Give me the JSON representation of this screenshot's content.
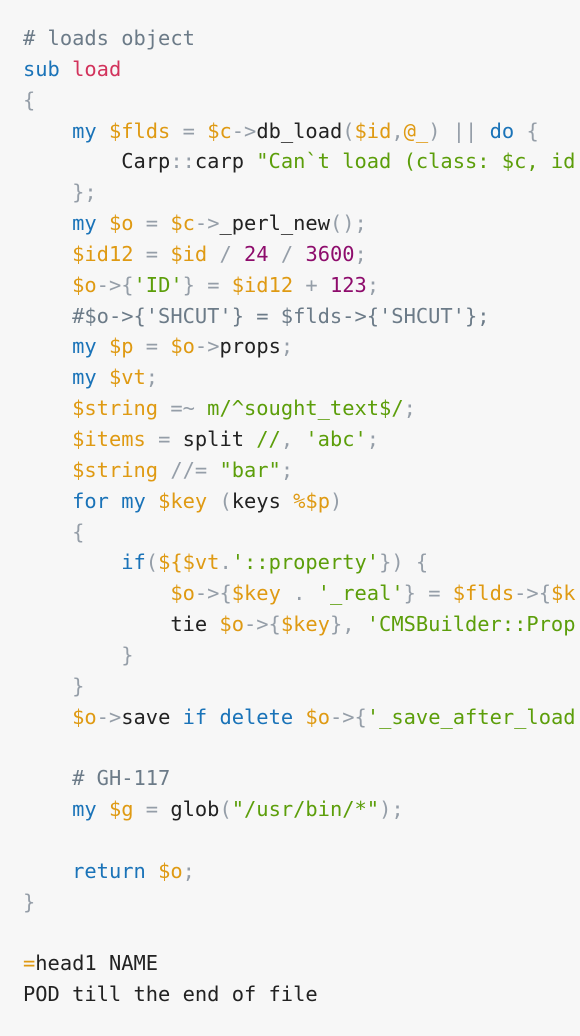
{
  "editor": {
    "background": "#f7f7f7",
    "token_colors": {
      "comment": "#6c7b88",
      "keyword": "#1a73b8",
      "function_name": "#d2335c",
      "variable": "#df9a13",
      "string": "#5c9e0a",
      "number": "#8e0c6c",
      "operator": "#959ea8",
      "plain": "#222222"
    },
    "lines": [
      [
        [
          "comment",
          "# loads object"
        ]
      ],
      [
        [
          "keyword",
          "sub"
        ],
        [
          "plain",
          " "
        ],
        [
          "func",
          "load"
        ]
      ],
      [
        [
          "op",
          "{"
        ]
      ],
      [
        [
          "plain",
          "    "
        ],
        [
          "keyword",
          "my"
        ],
        [
          "plain",
          " "
        ],
        [
          "var",
          "$flds"
        ],
        [
          "plain",
          " "
        ],
        [
          "op",
          "="
        ],
        [
          "plain",
          " "
        ],
        [
          "var",
          "$c"
        ],
        [
          "op",
          "->"
        ],
        [
          "plain",
          "db_load"
        ],
        [
          "op",
          "("
        ],
        [
          "var",
          "$id"
        ],
        [
          "op",
          ","
        ],
        [
          "var",
          "@_"
        ],
        [
          "op",
          ")"
        ],
        [
          "plain",
          " "
        ],
        [
          "op",
          "||"
        ],
        [
          "plain",
          " "
        ],
        [
          "keyword",
          "do"
        ],
        [
          "plain",
          " "
        ],
        [
          "op",
          "{"
        ]
      ],
      [
        [
          "plain",
          "        Carp"
        ],
        [
          "op",
          "::"
        ],
        [
          "plain",
          "carp "
        ],
        [
          "string",
          "\"Can`t load (class: $c, id"
        ]
      ],
      [
        [
          "plain",
          "    "
        ],
        [
          "op",
          "};"
        ]
      ],
      [
        [
          "plain",
          "    "
        ],
        [
          "keyword",
          "my"
        ],
        [
          "plain",
          " "
        ],
        [
          "var",
          "$o"
        ],
        [
          "plain",
          " "
        ],
        [
          "op",
          "="
        ],
        [
          "plain",
          " "
        ],
        [
          "var",
          "$c"
        ],
        [
          "op",
          "->"
        ],
        [
          "plain",
          "_perl_new"
        ],
        [
          "op",
          "();"
        ]
      ],
      [
        [
          "plain",
          "    "
        ],
        [
          "var",
          "$id12"
        ],
        [
          "plain",
          " "
        ],
        [
          "op",
          "="
        ],
        [
          "plain",
          " "
        ],
        [
          "var",
          "$id"
        ],
        [
          "plain",
          " "
        ],
        [
          "op",
          "/"
        ],
        [
          "plain",
          " "
        ],
        [
          "number",
          "24"
        ],
        [
          "plain",
          " "
        ],
        [
          "op",
          "/"
        ],
        [
          "plain",
          " "
        ],
        [
          "number",
          "3600"
        ],
        [
          "op",
          ";"
        ]
      ],
      [
        [
          "plain",
          "    "
        ],
        [
          "var",
          "$o"
        ],
        [
          "op",
          "->{"
        ],
        [
          "string",
          "'ID'"
        ],
        [
          "op",
          "}"
        ],
        [
          "plain",
          " "
        ],
        [
          "op",
          "="
        ],
        [
          "plain",
          " "
        ],
        [
          "var",
          "$id12"
        ],
        [
          "plain",
          " "
        ],
        [
          "op",
          "+"
        ],
        [
          "plain",
          " "
        ],
        [
          "number",
          "123"
        ],
        [
          "op",
          ";"
        ]
      ],
      [
        [
          "plain",
          "    "
        ],
        [
          "comment",
          "#$o->{'SHCUT'} = $flds->{'SHCUT'};"
        ]
      ],
      [
        [
          "plain",
          "    "
        ],
        [
          "keyword",
          "my"
        ],
        [
          "plain",
          " "
        ],
        [
          "var",
          "$p"
        ],
        [
          "plain",
          " "
        ],
        [
          "op",
          "="
        ],
        [
          "plain",
          " "
        ],
        [
          "var",
          "$o"
        ],
        [
          "op",
          "->"
        ],
        [
          "plain",
          "props"
        ],
        [
          "op",
          ";"
        ]
      ],
      [
        [
          "plain",
          "    "
        ],
        [
          "keyword",
          "my"
        ],
        [
          "plain",
          " "
        ],
        [
          "var",
          "$vt"
        ],
        [
          "op",
          ";"
        ]
      ],
      [
        [
          "plain",
          "    "
        ],
        [
          "var",
          "$string"
        ],
        [
          "plain",
          " "
        ],
        [
          "op",
          "=~"
        ],
        [
          "plain",
          " "
        ],
        [
          "string",
          "m/^sought_text$/"
        ],
        [
          "op",
          ";"
        ]
      ],
      [
        [
          "plain",
          "    "
        ],
        [
          "var",
          "$items"
        ],
        [
          "plain",
          " "
        ],
        [
          "op",
          "="
        ],
        [
          "plain",
          " split "
        ],
        [
          "string",
          "//"
        ],
        [
          "op",
          ","
        ],
        [
          "plain",
          " "
        ],
        [
          "string",
          "'abc'"
        ],
        [
          "op",
          ";"
        ]
      ],
      [
        [
          "plain",
          "    "
        ],
        [
          "var",
          "$string"
        ],
        [
          "plain",
          " "
        ],
        [
          "op",
          "//="
        ],
        [
          "plain",
          " "
        ],
        [
          "string",
          "\"bar\""
        ],
        [
          "op",
          ";"
        ]
      ],
      [
        [
          "plain",
          "    "
        ],
        [
          "keyword",
          "for"
        ],
        [
          "plain",
          " "
        ],
        [
          "keyword",
          "my"
        ],
        [
          "plain",
          " "
        ],
        [
          "var",
          "$key"
        ],
        [
          "plain",
          " "
        ],
        [
          "op",
          "("
        ],
        [
          "plain",
          "keys "
        ],
        [
          "var",
          "%$p"
        ],
        [
          "op",
          ")"
        ]
      ],
      [
        [
          "plain",
          "    "
        ],
        [
          "op",
          "{"
        ]
      ],
      [
        [
          "plain",
          "        "
        ],
        [
          "keyword",
          "if"
        ],
        [
          "op",
          "("
        ],
        [
          "var",
          "${$vt"
        ],
        [
          "op",
          "."
        ],
        [
          "string",
          "'::property'"
        ],
        [
          "op",
          "})"
        ],
        [
          "plain",
          " "
        ],
        [
          "op",
          "{"
        ]
      ],
      [
        [
          "plain",
          "            "
        ],
        [
          "var",
          "$o"
        ],
        [
          "op",
          "->{"
        ],
        [
          "var",
          "$key"
        ],
        [
          "plain",
          " "
        ],
        [
          "op",
          "."
        ],
        [
          "plain",
          " "
        ],
        [
          "string",
          "'_real'"
        ],
        [
          "op",
          "}"
        ],
        [
          "plain",
          " "
        ],
        [
          "op",
          "="
        ],
        [
          "plain",
          " "
        ],
        [
          "var",
          "$flds"
        ],
        [
          "op",
          "->{"
        ],
        [
          "var",
          "$k"
        ]
      ],
      [
        [
          "plain",
          "            tie "
        ],
        [
          "var",
          "$o"
        ],
        [
          "op",
          "->{"
        ],
        [
          "var",
          "$key"
        ],
        [
          "op",
          "},"
        ],
        [
          "plain",
          " "
        ],
        [
          "string",
          "'CMSBuilder::Prop"
        ]
      ],
      [
        [
          "plain",
          "        "
        ],
        [
          "op",
          "}"
        ]
      ],
      [
        [
          "plain",
          "    "
        ],
        [
          "op",
          "}"
        ]
      ],
      [
        [
          "plain",
          "    "
        ],
        [
          "var",
          "$o"
        ],
        [
          "op",
          "->"
        ],
        [
          "plain",
          "save "
        ],
        [
          "keyword",
          "if"
        ],
        [
          "plain",
          " "
        ],
        [
          "keyword",
          "delete"
        ],
        [
          "plain",
          " "
        ],
        [
          "var",
          "$o"
        ],
        [
          "op",
          "->{"
        ],
        [
          "string",
          "'_save_after_load"
        ]
      ],
      [],
      [
        [
          "plain",
          "    "
        ],
        [
          "comment",
          "# GH-117"
        ]
      ],
      [
        [
          "plain",
          "    "
        ],
        [
          "keyword",
          "my"
        ],
        [
          "plain",
          " "
        ],
        [
          "var",
          "$g"
        ],
        [
          "plain",
          " "
        ],
        [
          "op",
          "="
        ],
        [
          "plain",
          " glob"
        ],
        [
          "op",
          "("
        ],
        [
          "string",
          "\"/usr/bin/*\""
        ],
        [
          "op",
          ");"
        ]
      ],
      [],
      [
        [
          "plain",
          "    "
        ],
        [
          "keyword",
          "return"
        ],
        [
          "plain",
          " "
        ],
        [
          "var",
          "$o"
        ],
        [
          "op",
          ";"
        ]
      ],
      [
        [
          "op",
          "}"
        ]
      ],
      [],
      [
        [
          "var",
          "="
        ],
        [
          "plain",
          "head1 NAME"
        ]
      ],
      [
        [
          "plain",
          "POD till the end of file"
        ]
      ]
    ]
  }
}
